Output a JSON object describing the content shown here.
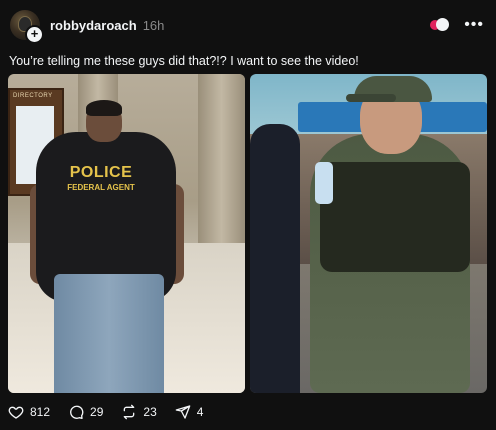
{
  "post": {
    "username": "robbydaroach",
    "timestamp": "16h",
    "caption": "You’re telling me these guys did that?!? I want to see the video!"
  },
  "media": {
    "left_photo": {
      "vest_text": "POLICE",
      "vest_subtext": "FEDERAL AGENT",
      "sign_label": "DIRECTORY"
    }
  },
  "actions": {
    "likes": "812",
    "comments": "29",
    "reposts": "23",
    "shares": "4"
  },
  "icons": {
    "more": "more-icon",
    "heart": "heart-icon",
    "comment": "comment-icon",
    "repost": "repost-icon",
    "share": "share-icon",
    "follow": "plus-icon"
  },
  "colors": {
    "background": "#101010",
    "text": "#f3f5f7",
    "muted": "#8a8a8a",
    "vest_text": "#e5c34b"
  }
}
